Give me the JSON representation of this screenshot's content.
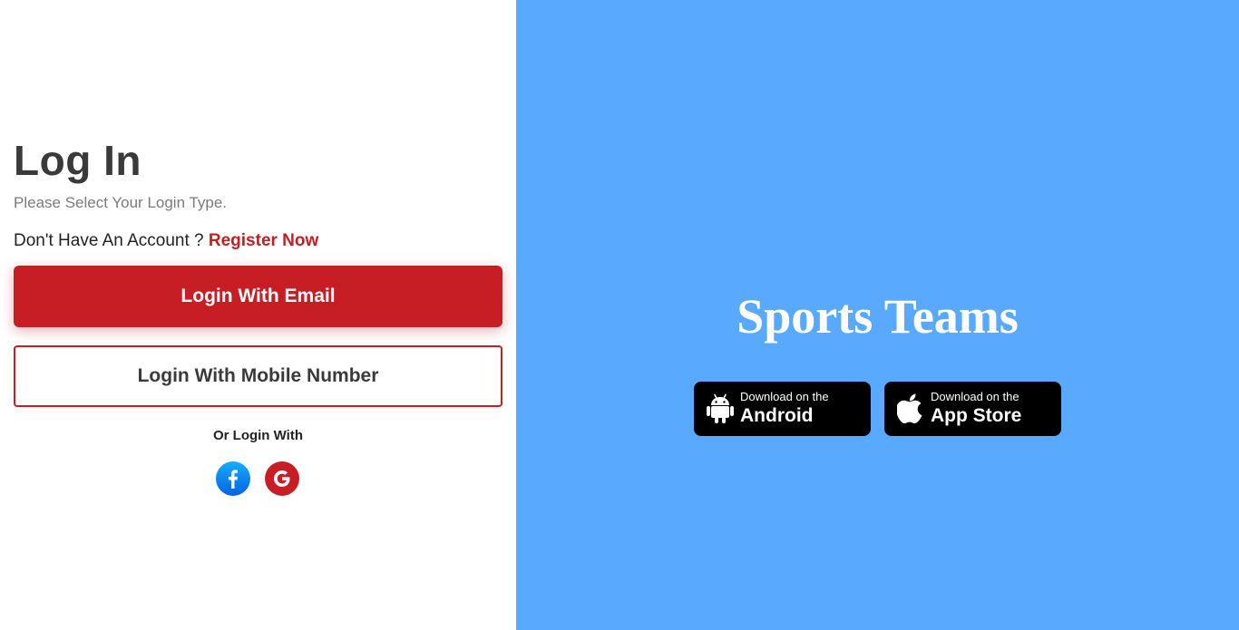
{
  "login": {
    "title": "Log In",
    "subtitle": "Please Select Your Login Type.",
    "no_account_text": "Don't Have An Account ? ",
    "register_link": "Register Now",
    "email_button": "Login With Email",
    "mobile_button": "Login With Mobile Number",
    "or_login_with": "Or Login With",
    "social": [
      {
        "name": "facebook",
        "icon": "facebook-icon",
        "color": "#1778f2"
      },
      {
        "name": "google",
        "icon": "google-icon",
        "color": "#c71e26"
      }
    ]
  },
  "promo": {
    "title": "Sports Teams",
    "background_color": "#58a9ff",
    "stores": [
      {
        "small": "Download on the",
        "big": "Android",
        "icon": "android-icon"
      },
      {
        "small": "Download on the",
        "big": "App Store",
        "icon": "apple-icon"
      }
    ]
  },
  "colors": {
    "accent": "#c71e26",
    "title_text": "#3a3a3a"
  }
}
